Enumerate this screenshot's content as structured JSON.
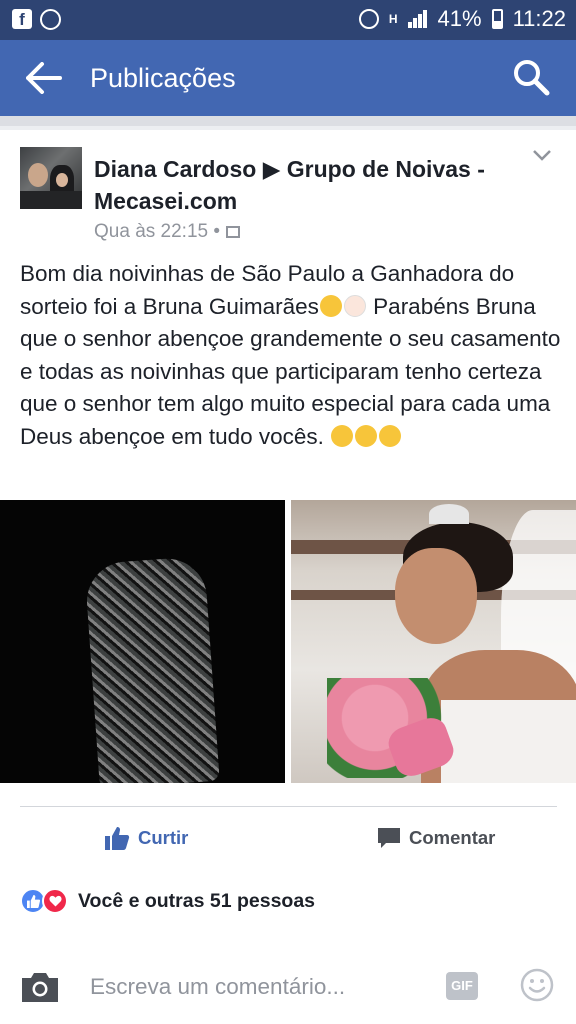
{
  "status_bar": {
    "battery": "41%",
    "time": "11:22",
    "network": "H"
  },
  "header": {
    "title": "Publicações"
  },
  "post": {
    "author_line": "Diana Cardoso ▶ Grupo de Noivas - Mecasei.com",
    "timestamp": "Qua às 22:15 •",
    "text": "Bom dia noivinhas de São Paulo a Ganhadora do sorteio foi a Bruna Guimarães",
    "text_2": "Parabéns Bruna que o senhor abençoe grandemente o seu casamento e todas as noivinhas que participaram tenho certeza que o senhor tem algo muito especial para cada uma Deus abençoe em tudo vocês. "
  },
  "actions": {
    "like_label": "Curtir",
    "comment_label": "Comentar"
  },
  "reactions": {
    "summary": "Você e outras 51 pessoas"
  },
  "comment_bar": {
    "placeholder": "Escreva um comentário...",
    "gif_label": "GIF"
  },
  "colors": {
    "status_bar": "#2e4473",
    "header": "#4267b2",
    "like_blue": "#4267b2",
    "love_red": "#f0284a"
  },
  "icons": [
    "facebook-icon",
    "whatsapp-icon",
    "alarm-icon",
    "signal-icon",
    "battery-icon",
    "back-arrow-icon",
    "search-icon",
    "chevron-down-icon",
    "audience-icon",
    "like-icon",
    "comment-icon",
    "camera-icon",
    "gif-icon",
    "smiley-icon"
  ]
}
